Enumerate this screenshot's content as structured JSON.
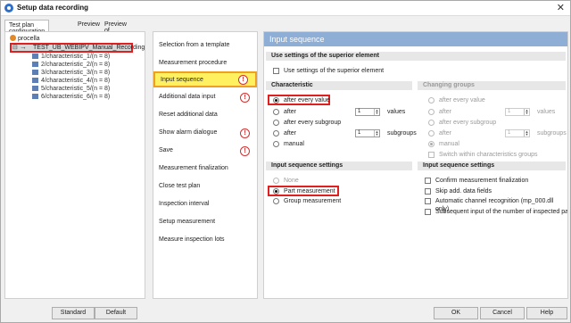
{
  "window": {
    "title": "Setup data recording",
    "close_glyph": "✕"
  },
  "tabs": [
    "Test plan configuration",
    "Preview",
    "Preview of template"
  ],
  "tree": {
    "root_label": "procella",
    "plan_label": "TEST_UB_WEBIPV_Manual_Recording",
    "characteristics": [
      "1/characteristic_1/(n = 8)",
      "2/characteristic_2/(n = 8)",
      "3/characteristic_3/(n = 8)",
      "4/characteristic_4/(n = 8)",
      "5/characteristic_5/(n = 8)",
      "6/characteristic_6/(n = 8)"
    ]
  },
  "nav": [
    {
      "label": "Selection from a template",
      "alert": false
    },
    {
      "label": "Measurement procedure",
      "alert": false
    },
    {
      "label": "Input sequence",
      "alert": true,
      "active": true
    },
    {
      "label": "Additional data input",
      "alert": true
    },
    {
      "label": "Reset additional data",
      "alert": false
    },
    {
      "label": "Show alarm dialogue",
      "alert": true
    },
    {
      "label": "Save",
      "alert": true
    },
    {
      "label": "Measurement finalization",
      "alert": false
    },
    {
      "label": "Close test plan",
      "alert": false
    },
    {
      "label": "Inspection interval",
      "alert": false
    },
    {
      "label": "Setup measurement",
      "alert": false
    },
    {
      "label": "Measure inspection lots",
      "alert": false
    }
  ],
  "alert_glyph": "!",
  "panel": {
    "title": "Input sequence",
    "superior_section": "Use settings of the superior element",
    "superior_checkbox": "Use settings of the superior element",
    "characteristic_section": "Characteristic",
    "changing_groups_section": "Changing groups",
    "char_options": {
      "after_every_value": "after every value",
      "after": "after",
      "values": "values",
      "after_every_subgroup": "after every subgroup",
      "after2": "after",
      "subgroups": "subgroups",
      "manual": "manual"
    },
    "groups_options": {
      "after_every_value": "after every value",
      "after": "after",
      "values": "values",
      "after_every_subgroup": "after every subgroup",
      "after2": "after",
      "subgroups": "subgroups",
      "manual": "manual",
      "switch_within": "Switch within characteristics groups"
    },
    "spin_value": "1",
    "input_settings_left": "Input sequence settings",
    "input_settings_right": "Input sequence settings",
    "left_options": {
      "none": "None",
      "part": "Part measurement",
      "group": "Group measurement"
    },
    "right_checks": {
      "confirm": "Confirm measurement finalization",
      "skip": "Skip add. data fields",
      "auto": "Automatic channel recognition (mp_000.dll only)",
      "subsequent": "Subsequent input of the number of inspected parts fo"
    }
  },
  "buttons": {
    "standard": "Standard",
    "default": "Default",
    "ok": "OK",
    "cancel": "Cancel",
    "help": "Help"
  }
}
